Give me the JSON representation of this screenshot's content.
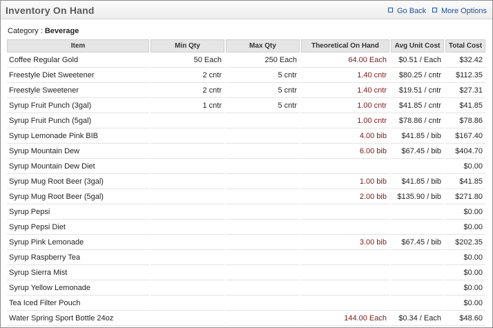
{
  "panel": {
    "title": "Inventory On Hand",
    "links": {
      "go_back": "Go Back",
      "more_options": "More Options"
    }
  },
  "category": {
    "label": "Category :",
    "value": "Beverage"
  },
  "table": {
    "columns": [
      "Item",
      "Min Qty",
      "Max Qty",
      "Theoretical On Hand",
      "Avg Unit Cost",
      "Total Cost"
    ],
    "rows": [
      [
        "Coffee Regular Gold",
        "50 Each",
        "250 Each",
        "64.00 Each",
        "$0.51 / Each",
        "$32.42"
      ],
      [
        "Freestyle Diet Sweetener",
        "2 cntr",
        "5 cntr",
        "1.40 cntr",
        "$80.25 / cntr",
        "$112.35"
      ],
      [
        "Freestyle Sweetener",
        "2 cntr",
        "5 cntr",
        "1.40 cntr",
        "$19.51 / cntr",
        "$27.31"
      ],
      [
        "Syrup Fruit Punch (3gal)",
        "1 cntr",
        "5 cntr",
        "1.00 cntr",
        "$41.85 / cntr",
        "$41.85"
      ],
      [
        "Syrup Fruit Punch (5gal)",
        "",
        "",
        "1.00 cntr",
        "$78.86 / cntr",
        "$78.86"
      ],
      [
        "Syrup Lemonade Pink BIB",
        "",
        "",
        "4.00 bib",
        "$41.85 / bib",
        "$167.40"
      ],
      [
        "Syrup Mountain Dew",
        "",
        "",
        "6.00 bib",
        "$67.45 / bib",
        "$404.70"
      ],
      [
        "Syrup Mountain Dew Diet",
        "",
        "",
        "",
        "",
        "$0.00"
      ],
      [
        "Syrup Mug Root Beer (3gal)",
        "",
        "",
        "1.00 bib",
        "$41.85 / bib",
        "$41.85"
      ],
      [
        "Syrup Mug Root Beer (5gal)",
        "",
        "",
        "2.00 bib",
        "$135.90 / bib",
        "$271.80"
      ],
      [
        "Syrup Pepsi",
        "",
        "",
        "",
        "",
        "$0.00"
      ],
      [
        "Syrup Pepsi Diet",
        "",
        "",
        "",
        "",
        "$0.00"
      ],
      [
        "Syrup Pink Lemonade",
        "",
        "",
        "3.00 bib",
        "$67.45 / bib",
        "$202.35"
      ],
      [
        "Syrup Raspberry Tea",
        "",
        "",
        "",
        "",
        "$0.00"
      ],
      [
        "Syrup Sierra Mist",
        "",
        "",
        "",
        "",
        "$0.00"
      ],
      [
        "Syrup Yellow Lemonade",
        "",
        "",
        "",
        "",
        "$0.00"
      ],
      [
        "Tea Iced Filter Pouch",
        "",
        "",
        "",
        "",
        "$0.00"
      ],
      [
        "Water Spring Sport Bottle 24oz",
        "",
        "",
        "144.00 Each",
        "$0.34 / Each",
        "$48.60"
      ]
    ]
  },
  "colors": {
    "theoretical_text": "#7b1a1a",
    "link": "#1a4fa0",
    "header_bg": "#e5e5e5"
  },
  "icons": {
    "link_bullet": "square-bullet-icon"
  }
}
